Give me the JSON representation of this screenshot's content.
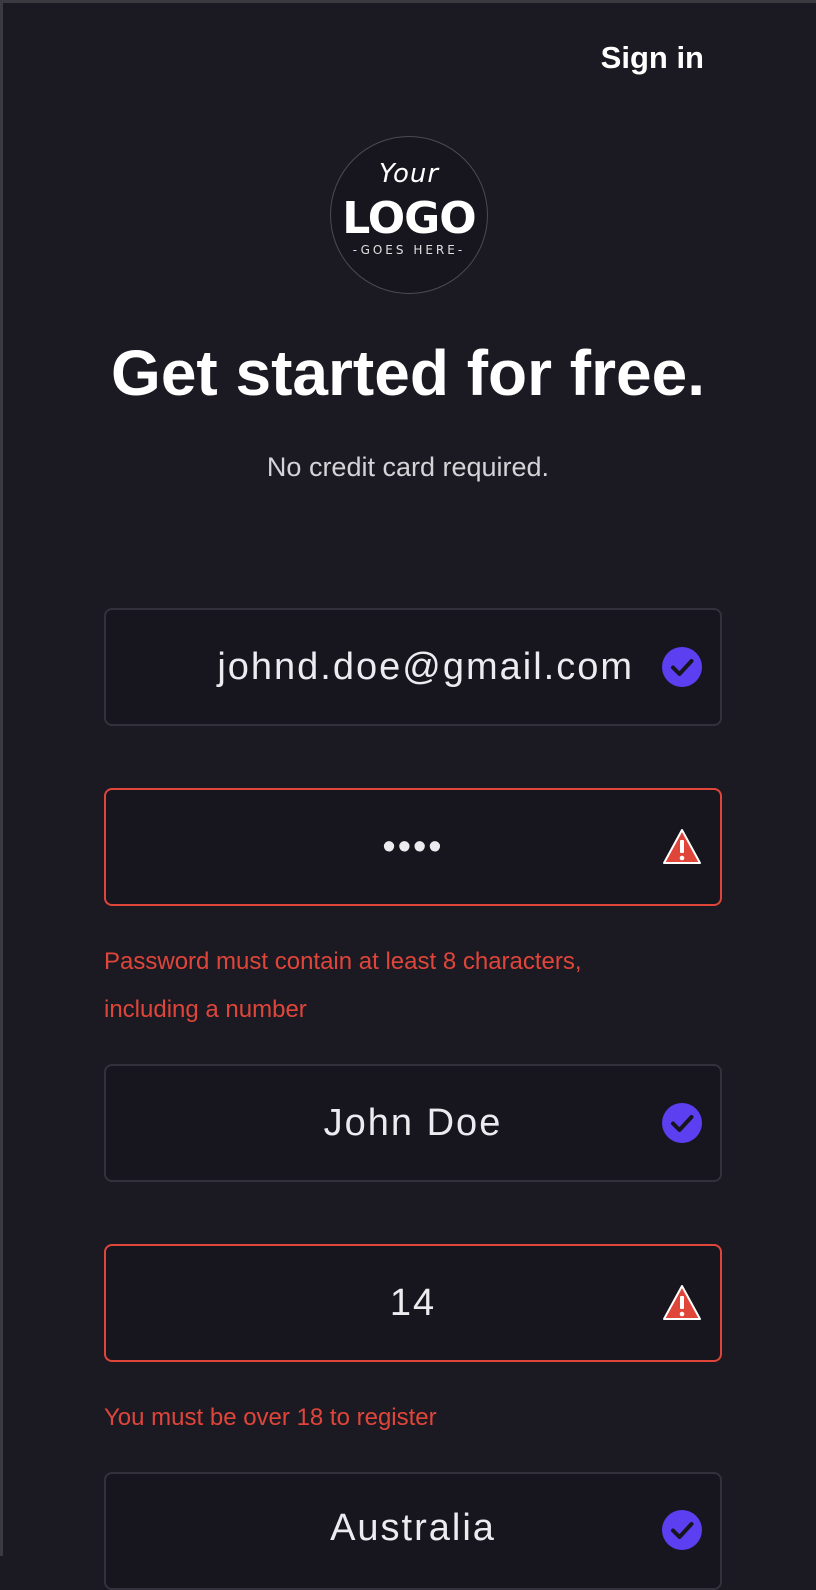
{
  "header": {
    "signin_label": "Sign in"
  },
  "logo": {
    "line1": "Your",
    "line2": "LOGO",
    "line3": "-GOES HERE-"
  },
  "page": {
    "title": "Get started for free.",
    "subtitle": "No credit card required."
  },
  "form": {
    "email": {
      "value": "johnd.doe@gmail.com",
      "status": "valid"
    },
    "password": {
      "value": "••••",
      "status": "error",
      "error": "Password must contain at least 8 characters, including a number"
    },
    "name": {
      "value": "John Doe",
      "status": "valid"
    },
    "age": {
      "value": "14",
      "status": "error",
      "error": "You must be over 18 to register"
    },
    "country": {
      "value": "Australia",
      "status": "valid"
    }
  },
  "colors": {
    "background": "#1b1a23",
    "accent": "#5b3ff0",
    "error": "#e0453a",
    "text": "#ffffff"
  },
  "icons": {
    "valid": "check-circle-icon",
    "error": "warning-triangle-icon"
  }
}
